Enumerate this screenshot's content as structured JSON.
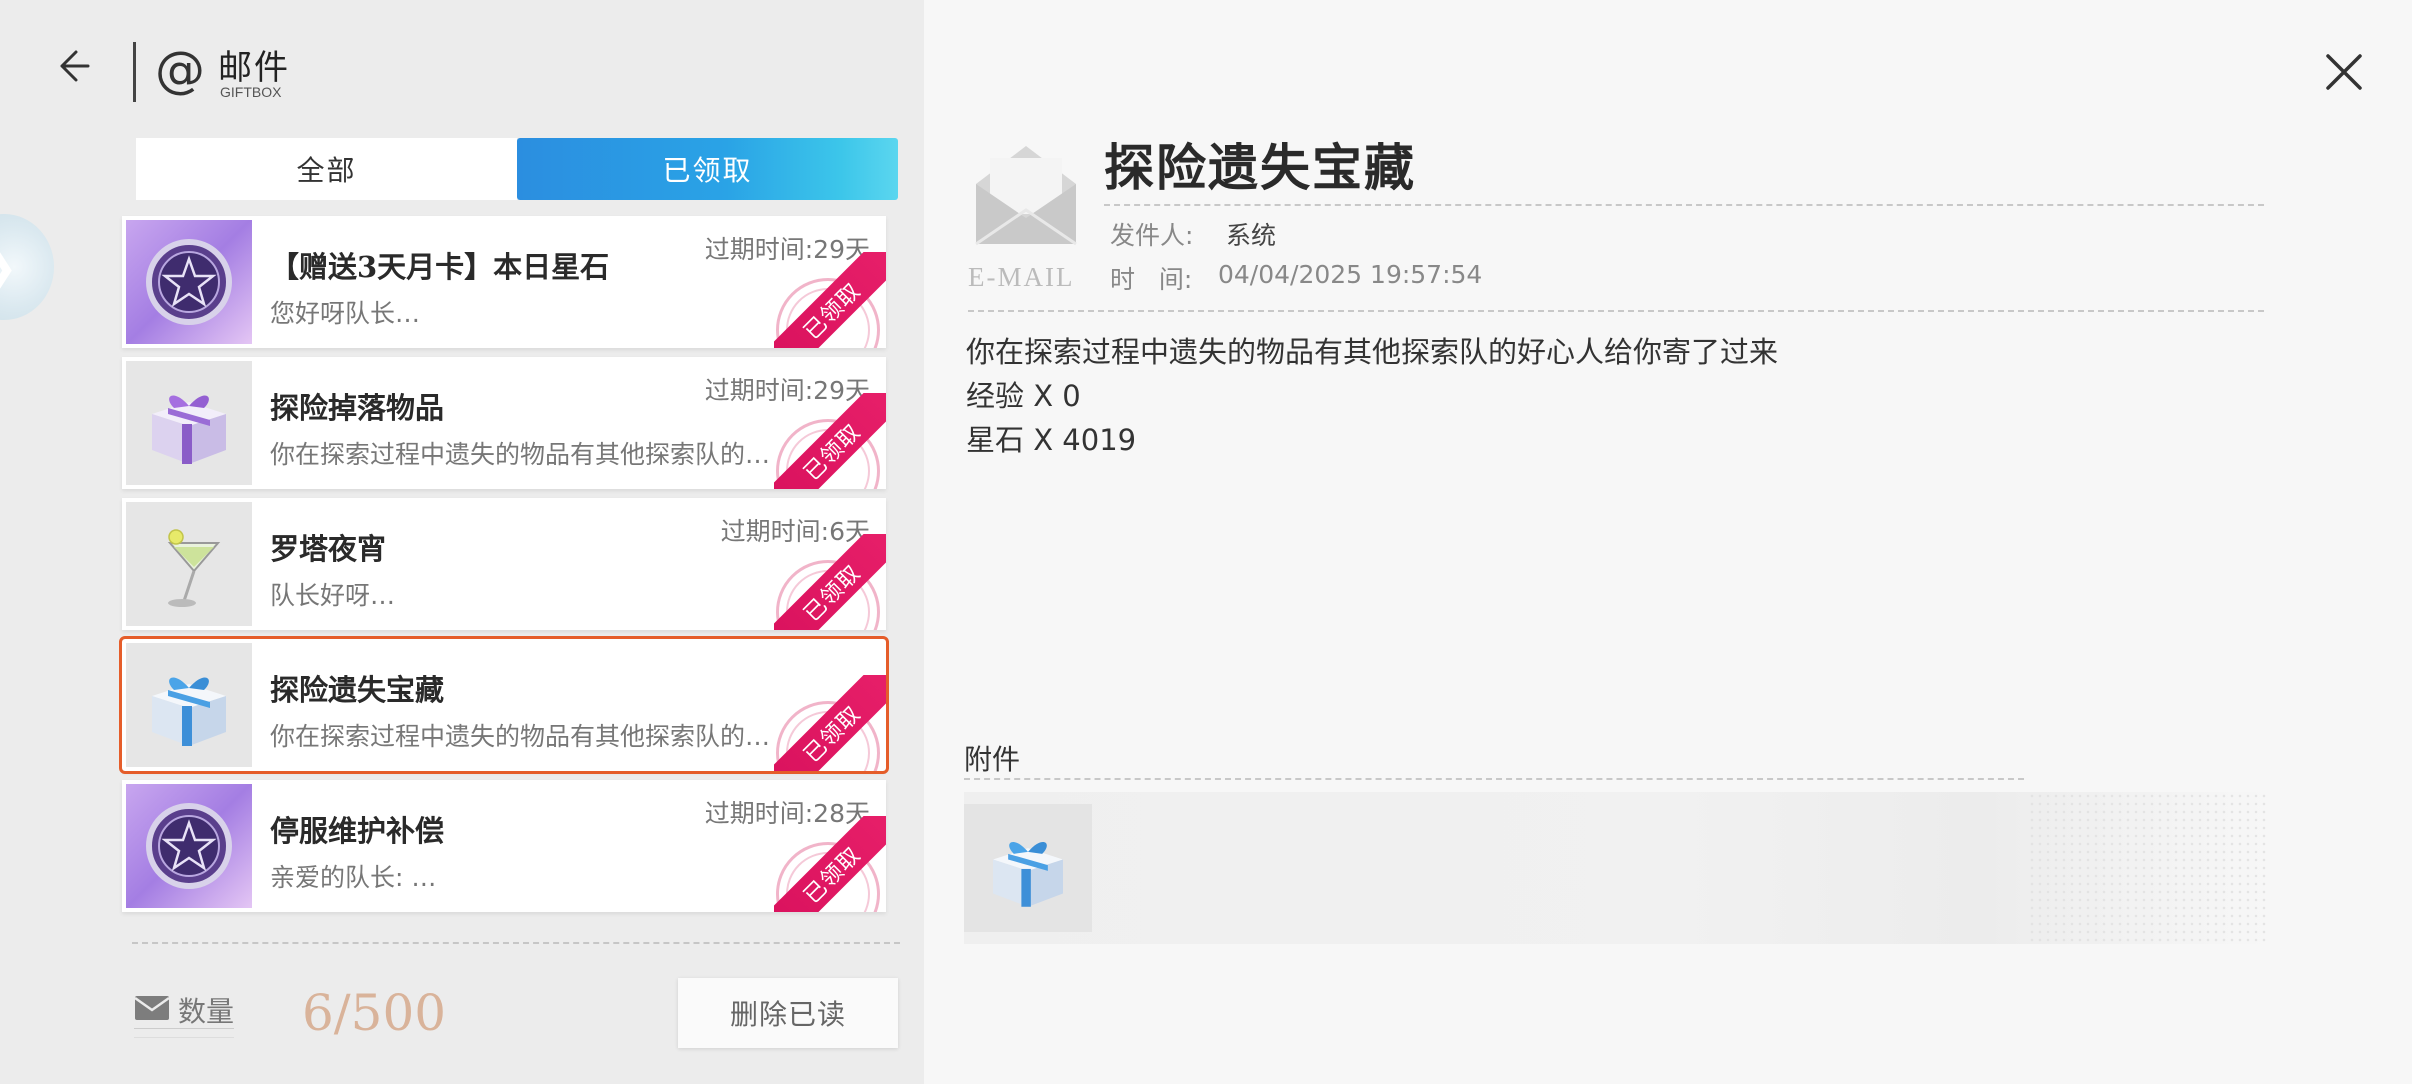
{
  "header": {
    "title": "邮件",
    "subtitle": "GIFTBOX",
    "back_icon": "arrow-left-icon",
    "mail_icon": "at-icon"
  },
  "tabs": [
    {
      "label": "全部",
      "active": false
    },
    {
      "label": "已领取",
      "active": true
    }
  ],
  "mail_list": [
    {
      "title": "【赠送3天月卡】本日星石",
      "preview": "您好呀队长…",
      "expire": "过期时间:29天",
      "status": "已领取",
      "icon": "star-medal-icon",
      "selected": false
    },
    {
      "title": "探险掉落物品",
      "preview": "你在探索过程中遗失的物品有其他探索队的好…",
      "expire": "过期时间:29天",
      "status": "已领取",
      "icon": "purple-gift-icon",
      "selected": false
    },
    {
      "title": "罗塔夜宵",
      "preview": "队长好呀…",
      "expire": "过期时间:6天",
      "status": "已领取",
      "icon": "cocktail-icon",
      "selected": false
    },
    {
      "title": "探险遗失宝藏",
      "preview": "你在探索过程中遗失的物品有其他探索队的好…",
      "expire": "",
      "status": "已领取",
      "icon": "blue-gift-icon",
      "selected": true
    },
    {
      "title": "停服维护补偿",
      "preview": "亲爱的队长: …",
      "expire": "过期时间:28天",
      "status": "已领取",
      "icon": "star-medal-icon",
      "selected": false
    }
  ],
  "footer": {
    "count_label": "数量",
    "count_value": "6/500",
    "delete_label": "删除已读"
  },
  "detail": {
    "email_label": "E-MAIL",
    "title": "探险遗失宝藏",
    "sender_label": "发件人:",
    "sender": "系统",
    "time_label": "时   间:",
    "time": "04/04/2025 19:57:54",
    "body_lines": [
      "你在探索过程中遗失的物品有其他探索队的好心人给你寄了过来",
      "经验 X 0",
      "星石 X 4019"
    ],
    "attachments_label": "附件",
    "attachments": [
      {
        "icon": "blue-gift-icon"
      }
    ]
  },
  "colors": {
    "accent_blue": "#2b8ee0",
    "claimed_red": "#d8105c",
    "selected_border": "#e55d2a",
    "count_color": "#d9b39a"
  }
}
